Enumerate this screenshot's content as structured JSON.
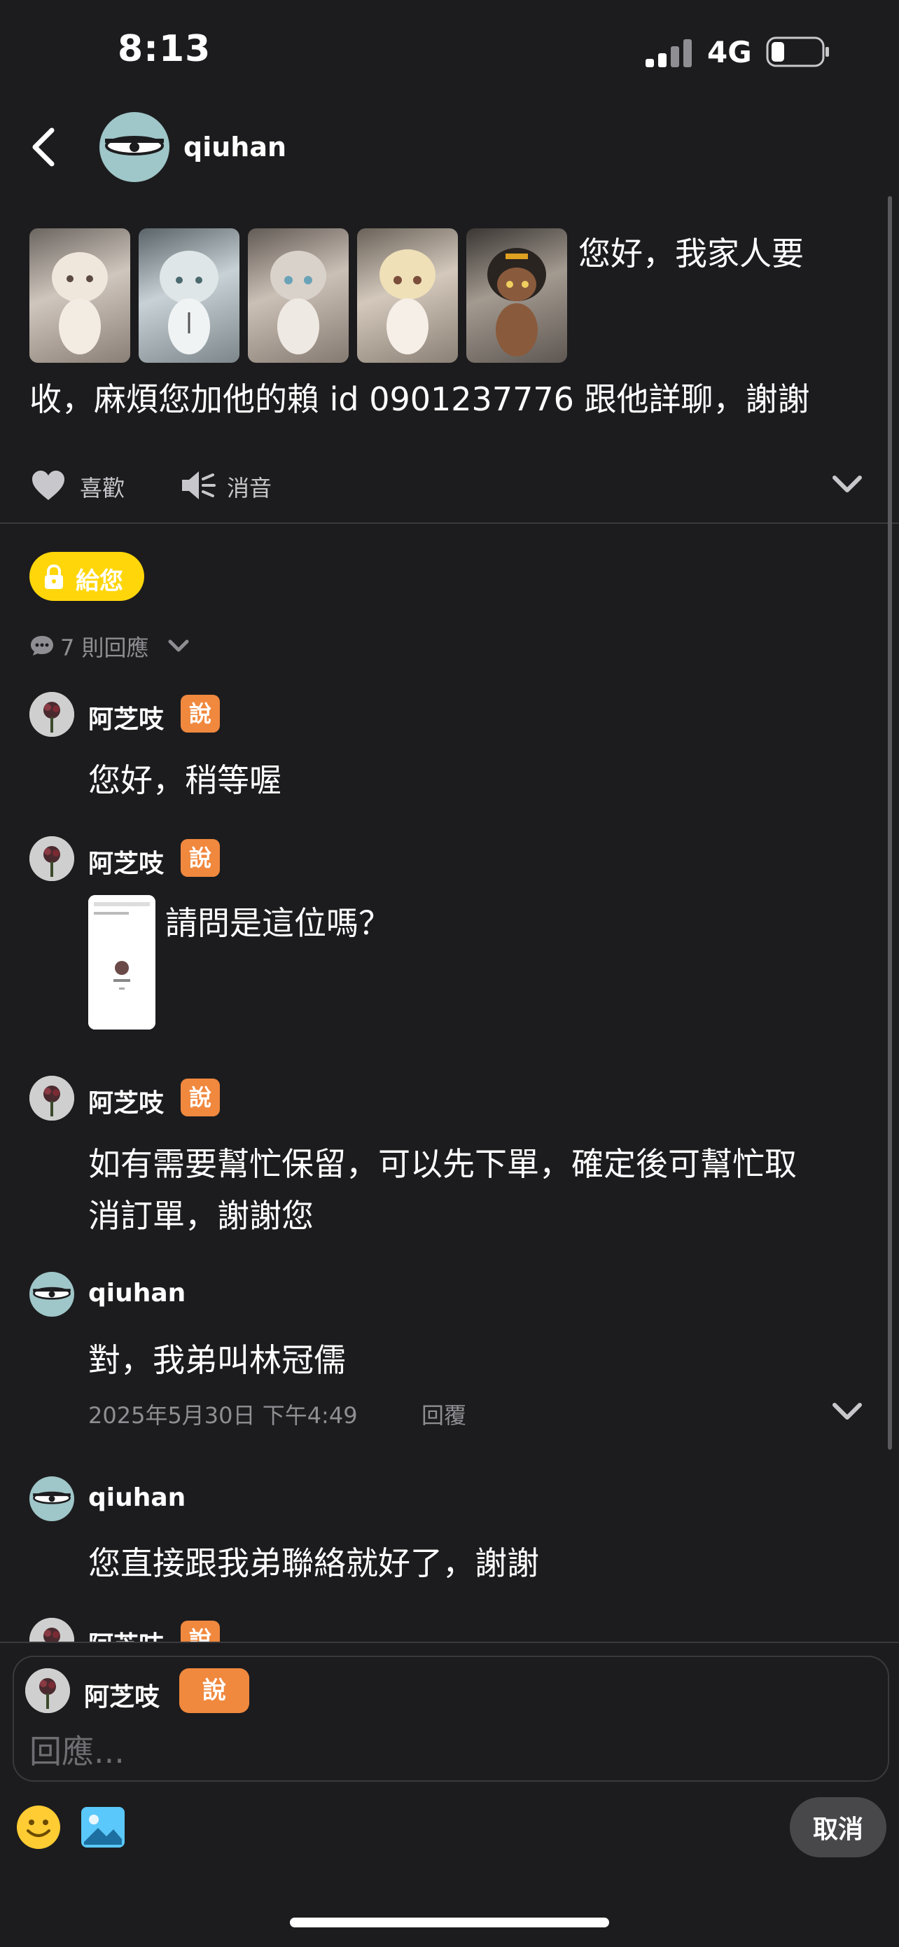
{
  "status_bar": {
    "time": "8:13",
    "network": "4G",
    "signal_icon": "signal-icon",
    "battery_icon": "battery-icon"
  },
  "header": {
    "username": "qiuhan",
    "back_icon": "chevron-left-icon"
  },
  "post": {
    "line1": "您好，我家人要",
    "line2": "收，麻煩您加他的賴 id 0901237776 跟他詳聊，謝謝",
    "thumbnail_count": 5
  },
  "actions": {
    "like_label": "喜歡",
    "mute_label": "消音"
  },
  "lock_pill": {
    "label": "給您"
  },
  "replies": {
    "count_label": "7 則回應"
  },
  "comments": [
    {
      "author": "阿芝吱",
      "badge": "說",
      "text": "您好，稍等喔"
    },
    {
      "author": "阿芝吱",
      "badge": "說",
      "text": "請問是這位嗎？"
    },
    {
      "author": "阿芝吱",
      "badge": "說",
      "text_line1": "如有需要幫忙保留，可以先下單，確定後可幫忙取",
      "text_line2": "消訂單，謝謝您"
    },
    {
      "author": "qiuhan",
      "text": "對，我弟叫林冠儒",
      "timestamp": "2025年5月30日 下午4:49",
      "reply_label": "回覆"
    },
    {
      "author": "qiuhan",
      "text": "您直接跟我弟聯絡就好了，謝謝"
    },
    {
      "author": "阿芝吱",
      "badge": "說"
    }
  ],
  "composer": {
    "author": "阿芝吱",
    "badge": "說",
    "placeholder": "回應...",
    "cancel_label": "取消"
  },
  "colors": {
    "background": "#1c1c1e",
    "badge": "#f0883e",
    "lock_pill": "#ffd60a",
    "muted_text": "#8e8e93"
  }
}
